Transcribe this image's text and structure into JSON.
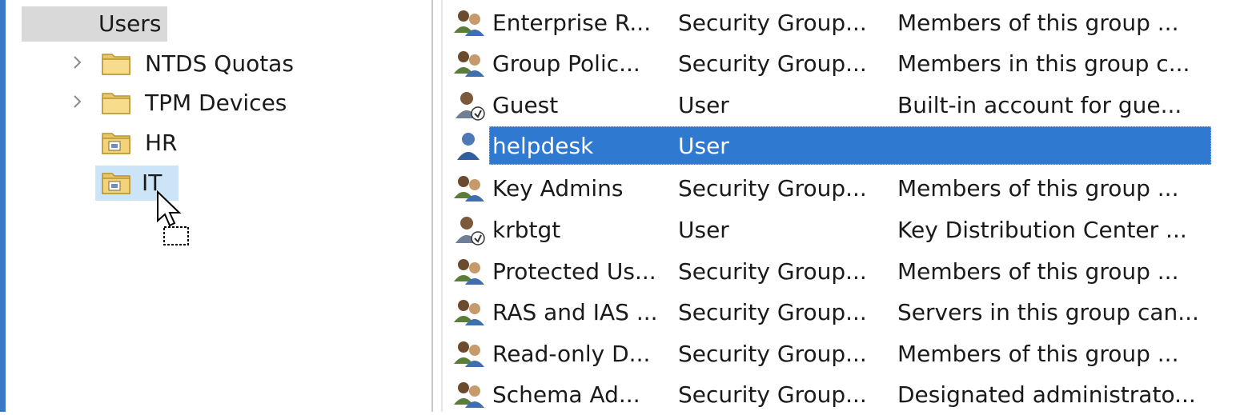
{
  "tree": {
    "items": [
      {
        "label": "Users",
        "has_chevron": false,
        "folder": "plain",
        "state": "gray"
      },
      {
        "label": "NTDS Quotas",
        "has_chevron": true,
        "folder": "plain",
        "state": "none"
      },
      {
        "label": "TPM Devices",
        "has_chevron": true,
        "folder": "plain",
        "state": "none"
      },
      {
        "label": "HR",
        "has_chevron": false,
        "folder": "ou",
        "state": "none"
      },
      {
        "label": "IT",
        "has_chevron": false,
        "folder": "ou",
        "state": "hover"
      }
    ]
  },
  "list": {
    "rows": [
      {
        "name": "Enterprise R...",
        "type": "Security Group...",
        "description": "Members of this group ...",
        "icon": "group-icon",
        "selected": false
      },
      {
        "name": "Group Polic...",
        "type": "Security Group...",
        "description": "Members in this group c...",
        "icon": "group-icon",
        "selected": false
      },
      {
        "name": "Guest",
        "type": "User",
        "description": "Built-in account for gue...",
        "icon": "disabled-user-icon",
        "selected": false
      },
      {
        "name": "helpdesk",
        "type": "User",
        "description": "",
        "icon": "user-icon",
        "selected": true
      },
      {
        "name": "Key Admins",
        "type": "Security Group...",
        "description": "Members of this group ...",
        "icon": "group-icon",
        "selected": false
      },
      {
        "name": "krbtgt",
        "type": "User",
        "description": "Key Distribution Center ...",
        "icon": "disabled-user-icon",
        "selected": false
      },
      {
        "name": "Protected Us...",
        "type": "Security Group...",
        "description": "Members of this group ...",
        "icon": "group-icon",
        "selected": false
      },
      {
        "name": "RAS and IAS ...",
        "type": "Security Group...",
        "description": "Servers in this group can...",
        "icon": "group-icon",
        "selected": false
      },
      {
        "name": "Read-only D...",
        "type": "Security Group...",
        "description": "Members of this group ...",
        "icon": "group-icon",
        "selected": false
      },
      {
        "name": "Schema Ad...",
        "type": "Security Group...",
        "description": "Designated administrato...",
        "icon": "group-icon",
        "selected": false
      }
    ]
  },
  "colors": {
    "selection_blue": "#3079d0",
    "hover_light": "#cce4f7",
    "selected_gray": "#d9d9d9",
    "window_edge": "#3b79c7"
  }
}
